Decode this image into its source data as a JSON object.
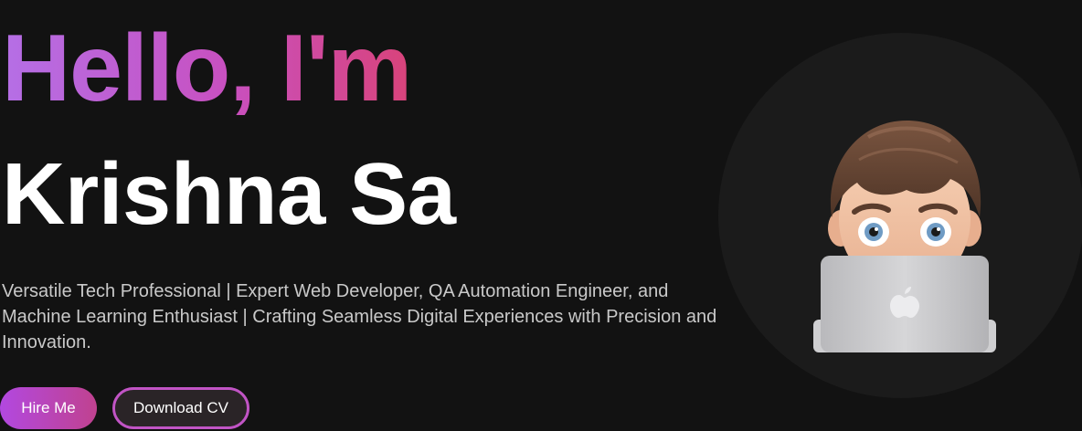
{
  "hero": {
    "greeting": "Hello, I'm",
    "name": "Krishna Sa",
    "tagline": "Versatile Tech Professional | Expert Web Developer, QA Automation Engineer, and Machine Learning Enthusiast | Crafting Seamless Digital Experiences with Precision and Innovation.",
    "hire_label": "Hire Me",
    "cv_label": "Download CV",
    "avatar_icon": "memoji-avatar-with-laptop"
  },
  "colors": {
    "background": "#121212",
    "gradient_start": "#b56fe6",
    "gradient_end": "#d9437a",
    "avatar_circle": "#1b1b1b",
    "cv_border": "#c154c5"
  }
}
